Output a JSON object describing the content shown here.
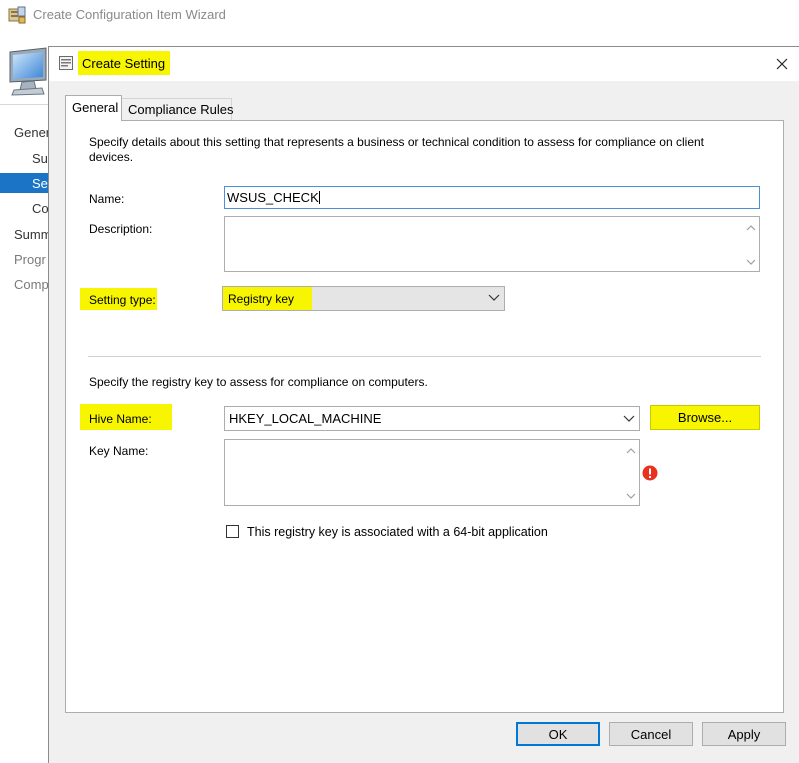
{
  "wizard": {
    "title": "Create Configuration Item Wizard",
    "nav": [
      "Gener",
      "Su",
      "Set",
      "Co",
      "Summ",
      "Progr",
      "Comp"
    ]
  },
  "dialog": {
    "title": "Create Setting",
    "tabs": [
      "General",
      "Compliance Rules"
    ],
    "intro": "Specify details about this setting that represents a business or technical condition to assess for compliance on client",
    "intro_line2": "devices.",
    "name_label": "Name:",
    "name_value": "WSUS_CHECK",
    "description_label": "Description:",
    "description_value": "",
    "setting_type_label": "Setting type:",
    "setting_type_value": "Registry key",
    "registry_intro": "Specify the registry key to assess for compliance on computers.",
    "hive_label": "Hive Name:",
    "hive_value": "HKEY_LOCAL_MACHINE",
    "browse_label": "Browse...",
    "key_label": "Key Name:",
    "key_value": "",
    "checkbox_64bit_label": "This registry key is associated with a 64-bit application",
    "checkbox_64bit_checked": false,
    "ok_label": "OK",
    "cancel_label": "Cancel",
    "apply_label": "Apply"
  },
  "colors": {
    "highlight": "#f7f600",
    "selection": "#1b74c5",
    "focus_border": "#4d8ed8",
    "error": "#e8321e"
  },
  "icons": {
    "wizard_app": "wizard-app-icon",
    "computer": "computer-monitor-icon",
    "dialog": "dialog-document-icon",
    "close": "close-icon",
    "dropdown": "chevron-down-icon",
    "scroll_up": "scroll-up-arrow-icon",
    "scroll_down": "scroll-down-arrow-icon",
    "error": "error-icon"
  }
}
